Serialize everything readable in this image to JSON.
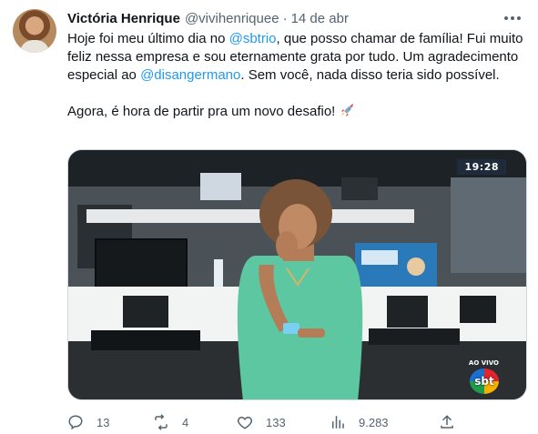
{
  "author": {
    "name": "Victória Henrique",
    "handle": "@vivihenriquee",
    "separator": "·",
    "date": "14 de abr"
  },
  "tweet": {
    "p1_a": "Hoje foi meu último dia no ",
    "p1_m1": "@sbtrio",
    "p1_b": ", que posso chamar de família! Fui muito feliz nessa empresa e sou eternamente grata por tudo. Um agradecimento especial ao ",
    "p1_m2": "@disangermano",
    "p1_c": ". Sem você, nada disso teria sido possível.",
    "p2": "Agora, é hora de partir pra um novo desafio! "
  },
  "media": {
    "clock": "19:28",
    "live_label": "AO VIVO",
    "logo_text": "sbt"
  },
  "actions": {
    "replies": "13",
    "retweets": "4",
    "likes": "133",
    "views": "9.283"
  },
  "icons": {
    "avatar": "profile-photo",
    "more": "more-dots-icon",
    "rocket": "rocket-emoji",
    "reply": "reply-icon",
    "retweet": "retweet-icon",
    "like": "heart-icon",
    "views": "views-chart-icon",
    "share": "share-icon"
  },
  "colors": {
    "text": "#0f1419",
    "secondary": "#536471",
    "link": "#1d9bf0",
    "border": "#cfd9de"
  }
}
